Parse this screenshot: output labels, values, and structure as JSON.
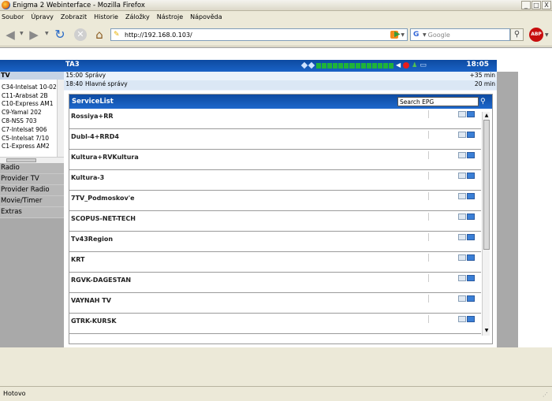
{
  "window": {
    "title": "Enigma 2 Webinterface - Mozilla Firefox",
    "buttons": [
      "_",
      "□",
      "X"
    ]
  },
  "menubar": [
    "Soubor",
    "Úpravy",
    "Zobrazit",
    "Historie",
    "Záložky",
    "Nástroje",
    "Nápověda"
  ],
  "toolbar": {
    "url": "http://192.168.0.103/",
    "search_placeholder": "Google",
    "abp_label": "ABP"
  },
  "banner": {
    "channel": "TA3",
    "time": "18:05"
  },
  "epg_now": [
    {
      "time": "15:00",
      "title": "Správy",
      "remaining": "+35 min"
    },
    {
      "time": "18:40",
      "title": "Hlavné správy",
      "remaining": "20 min"
    }
  ],
  "sidebar": {
    "tv_label": "TV",
    "satellites": [
      "C34-Intelsat 10-02",
      "C11-Arabsat 2B",
      "C10-Express AM1",
      "C9-Yamal 202",
      "C8-NSS 703",
      "C7-Intelsat 906",
      "C5-Intelsat 7/10",
      "C1-Express AM2"
    ],
    "items": [
      "Radio",
      "Provider TV",
      "Provider Radio",
      "Movie/Timer",
      "Extras"
    ]
  },
  "service_list": {
    "title": "ServiceList",
    "search_value": "Search EPG",
    "services": [
      "Rossiya+RR",
      "Dubl-4+RRD4",
      "Kultura+RVKultura",
      "Kultura-3",
      "7TV_Podmoskov'e",
      "SCOPUS-NET-TECH",
      "Tv43Region",
      "KRT",
      "RGVK-DAGESTAN",
      "VAYNAH TV",
      "GTRK-KURSK"
    ]
  },
  "status": {
    "text": "Hotovo"
  },
  "colors": {
    "banner_blue": "#1a5bb8",
    "signal_green": "#1fb23a",
    "record_red": "#e81c1c"
  }
}
